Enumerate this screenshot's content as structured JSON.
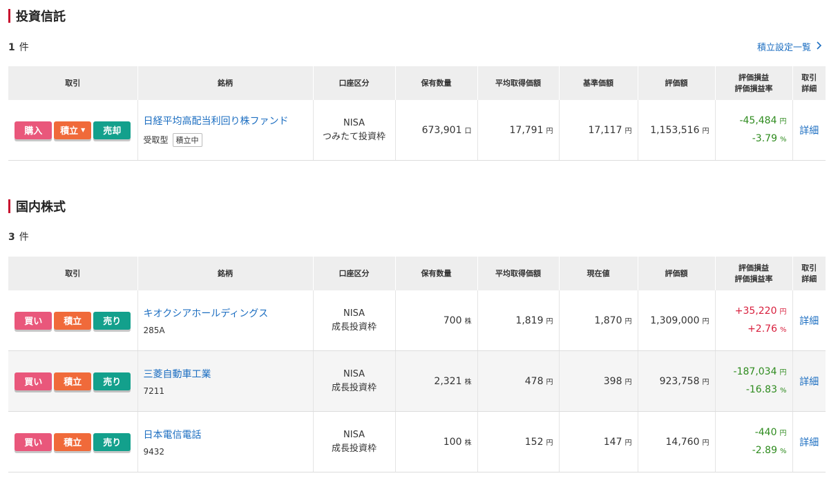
{
  "funds": {
    "title": "投資信託",
    "count_value": "1",
    "count_unit": "件",
    "settings_link": "積立設定一覧",
    "headers": [
      "取引",
      "銘柄",
      "口座区分",
      "保有数量",
      "平均取得価額",
      "基準価額",
      "評価額",
      "評価損益",
      "評価損益率",
      "取引",
      "詳細"
    ],
    "rows": [
      {
        "btn1": "購入",
        "btn2": "積立",
        "btn2_caret": "▼",
        "btn3": "売却",
        "name": "日経平均高配当利回り株ファンド",
        "sub": "受取型",
        "badge": "積立中",
        "account1": "NISA",
        "account2": "つみたて投資枠",
        "qty": "673,901",
        "qty_unit": "口",
        "avg": "17,791",
        "avg_unit": "円",
        "price": "17,117",
        "price_unit": "円",
        "value": "1,153,516",
        "value_unit": "円",
        "pl": "-45,484",
        "pl_unit": "円",
        "plr": "-3.79",
        "plr_unit": "%",
        "detail": "詳細"
      }
    ]
  },
  "stocks": {
    "title": "国内株式",
    "count_value": "3",
    "count_unit": "件",
    "headers": [
      "取引",
      "銘柄",
      "口座区分",
      "保有数量",
      "平均取得価額",
      "現在値",
      "評価額",
      "評価損益",
      "評価損益率",
      "取引",
      "詳細"
    ],
    "rows": [
      {
        "btn1": "買い",
        "btn2": "積立",
        "btn3": "売り",
        "name": "キオクシアホールディングス",
        "code": "285A",
        "account1": "NISA",
        "account2": "成長投資枠",
        "qty": "700",
        "qty_unit": "株",
        "avg": "1,819",
        "avg_unit": "円",
        "price": "1,870",
        "price_unit": "円",
        "value": "1,309,000",
        "value_unit": "円",
        "pl": "+35,220",
        "pl_unit": "円",
        "plr": "+2.76",
        "plr_unit": "%",
        "detail": "詳細"
      },
      {
        "btn1": "買い",
        "btn2": "積立",
        "btn3": "売り",
        "name": "三菱自動車工業",
        "code": "7211",
        "account1": "NISA",
        "account2": "成長投資枠",
        "qty": "2,321",
        "qty_unit": "株",
        "avg": "478",
        "avg_unit": "円",
        "price": "398",
        "price_unit": "円",
        "value": "923,758",
        "value_unit": "円",
        "pl": "-187,034",
        "pl_unit": "円",
        "plr": "-16.83",
        "plr_unit": "%",
        "detail": "詳細"
      },
      {
        "btn1": "買い",
        "btn2": "積立",
        "btn3": "売り",
        "name": "日本電信電話",
        "code": "9432",
        "account1": "NISA",
        "account2": "成長投資枠",
        "qty": "100",
        "qty_unit": "株",
        "avg": "152",
        "avg_unit": "円",
        "price": "147",
        "price_unit": "円",
        "value": "14,760",
        "value_unit": "円",
        "pl": "-440",
        "pl_unit": "円",
        "plr": "-2.89",
        "plr_unit": "%",
        "detail": "詳細"
      }
    ]
  },
  "colors": {
    "accent_bar": "#c8102e",
    "link": "#1c6ec1",
    "buy": "#e9577b",
    "tsumitate": "#f06a3a",
    "sell": "#13a08c",
    "gain": "#d81e3c",
    "loss": "#2e8b1e"
  }
}
